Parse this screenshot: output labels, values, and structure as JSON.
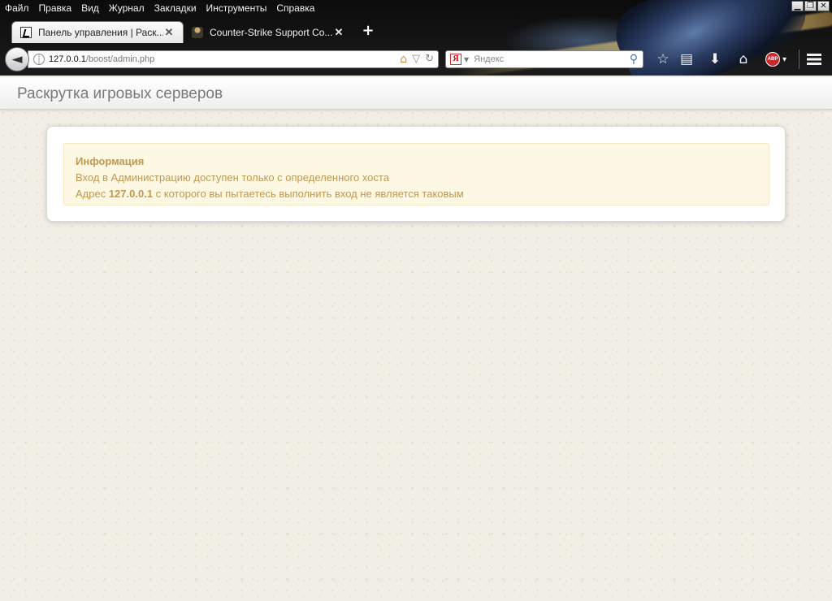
{
  "menubar": {
    "items": [
      {
        "label": "Файл"
      },
      {
        "label": "Правка"
      },
      {
        "label": "Вид"
      },
      {
        "label": "Журнал"
      },
      {
        "label": "Закладки"
      },
      {
        "label": "Инструменты"
      },
      {
        "label": "Справка"
      }
    ]
  },
  "window_controls": {
    "minimize": "▁",
    "maximize": "❐",
    "close": "✕"
  },
  "tabs": [
    {
      "label": "Панель управления | Раск...",
      "close": "✕"
    },
    {
      "label": "Counter-Strike Support Co...",
      "close": "✕"
    }
  ],
  "new_tab": "+",
  "navbar": {
    "back": "◄",
    "url_host": "127.0.0.1",
    "url_path": "/boost/admin.php",
    "url_home": "⌂",
    "url_bookmark_star": "▽",
    "url_reload": "↻",
    "search_logo": "Я",
    "search_placeholder": "Яндекс",
    "search_go": "⚲"
  },
  "toolbar": {
    "bookmark": "☆",
    "reader": "▤",
    "download": "⬇",
    "home": "⌂",
    "adblock": "ABP",
    "adblock_arrow": "▾"
  },
  "site": {
    "brand": "Раскрутка игровых серверов"
  },
  "alert": {
    "title": "Информация",
    "line1": "Вход в Администрацию доступен только с определенного хоста",
    "line2_prefix": "Адрес ",
    "line2_ip": "127.0.0.1",
    "line2_suffix": " с которого вы пытаетесь выполнить вход не является таковым"
  }
}
